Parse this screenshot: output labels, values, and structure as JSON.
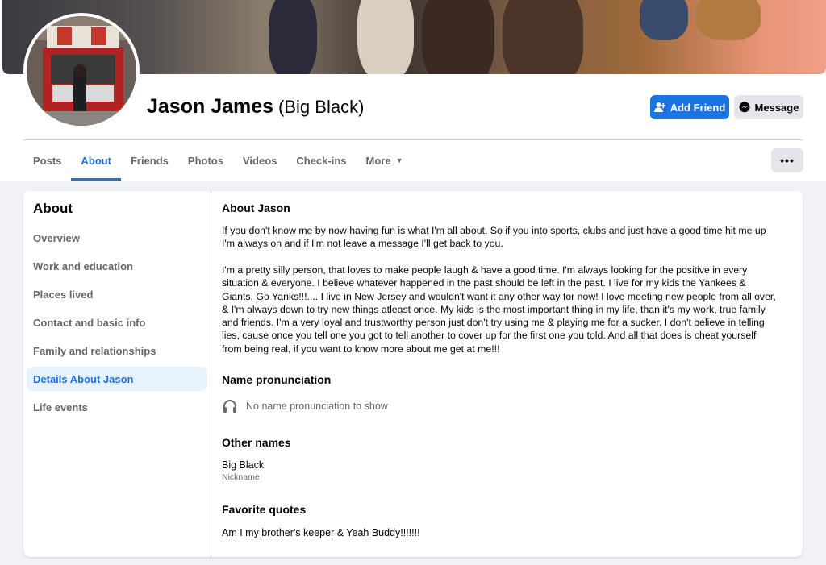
{
  "profile": {
    "name": "Jason James",
    "nickname_display": "(Big Black)"
  },
  "actions": {
    "add_friend": "Add Friend",
    "message": "Message",
    "more": "•••"
  },
  "tabs": [
    {
      "label": "Posts"
    },
    {
      "label": "About"
    },
    {
      "label": "Friends"
    },
    {
      "label": "Photos"
    },
    {
      "label": "Videos"
    },
    {
      "label": "Check-ins"
    },
    {
      "label": "More"
    }
  ],
  "sidebar": {
    "title": "About",
    "items": [
      {
        "label": "Overview"
      },
      {
        "label": "Work and education"
      },
      {
        "label": "Places lived"
      },
      {
        "label": "Contact and basic info"
      },
      {
        "label": "Family and relationships"
      },
      {
        "label": "Details About Jason"
      },
      {
        "label": "Life events"
      }
    ]
  },
  "details": {
    "about_title": "About Jason",
    "bio_p1": "If you don't know me by now having fun is what I'm all about. So if you into sports, clubs and just have a good time hit me up I'm always on and if I'm not leave a message I'll get back to you.",
    "bio_p2": "I'm a pretty silly person, that loves to make people laugh & have a good time. I'm always looking for the positive in every situation & everyone. I believe whatever happened in the past should be left in the past. I live for my kids the Yankees & Giants. Go Yanks!!!.... I live in New Jersey and wouldn't want it any other way for now! I love meeting new people from all over, & I'm always down to try new things atleast once. My kids is the most important thing in my life, than it's my work, true family and friends. I'm a very loyal and trustworthy person just don't try using me & playing me for a sucker. I don't believe in telling lies, cause once you tell one you got to tell another to cover up for the first one you told. And all that does is cheat yourself from being real, if you want to know more about me get at me!!!",
    "pronunciation_title": "Name pronunciation",
    "pronunciation_empty": "No name pronunciation to show",
    "other_names_title": "Other names",
    "other_name": "Big Black",
    "other_name_type": "Nickname",
    "quotes_title": "Favorite quotes",
    "quote": "Am I my brother's keeper & Yeah Buddy!!!!!!!"
  },
  "colors": {
    "accent": "#1b74e4",
    "page_bg": "#f0f2f5",
    "active_item_bg": "#e7f3ff"
  }
}
